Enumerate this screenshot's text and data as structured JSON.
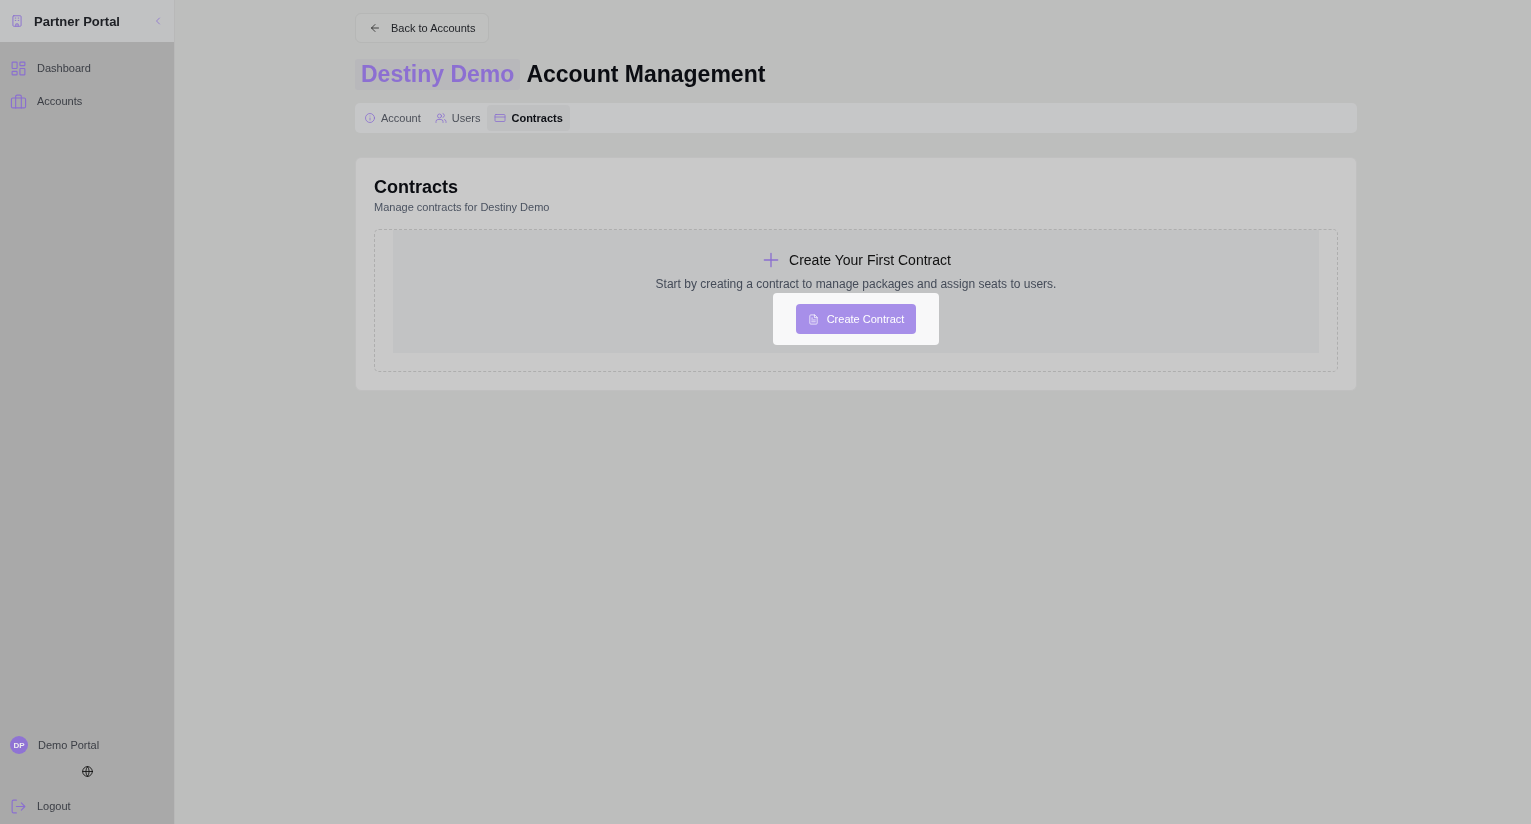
{
  "sidebar": {
    "title": "Partner Portal",
    "items": [
      {
        "label": "Dashboard"
      },
      {
        "label": "Accounts"
      }
    ],
    "user": {
      "initials": "DP",
      "name": "Demo Portal"
    },
    "logout": "Logout"
  },
  "back_button": "Back to Accounts",
  "heading": {
    "account": "Destiny Demo",
    "title": "Account Management"
  },
  "tabs": [
    {
      "label": "Account",
      "selected": false
    },
    {
      "label": "Users",
      "selected": false
    },
    {
      "label": "Contracts",
      "selected": true
    }
  ],
  "card": {
    "title": "Contracts",
    "subtitle": "Manage contracts for Destiny Demo",
    "empty_title": "Create Your First Contract",
    "empty_text": "Start by creating a contract to manage packages and assign seats to users.",
    "button": "Create Contract"
  }
}
